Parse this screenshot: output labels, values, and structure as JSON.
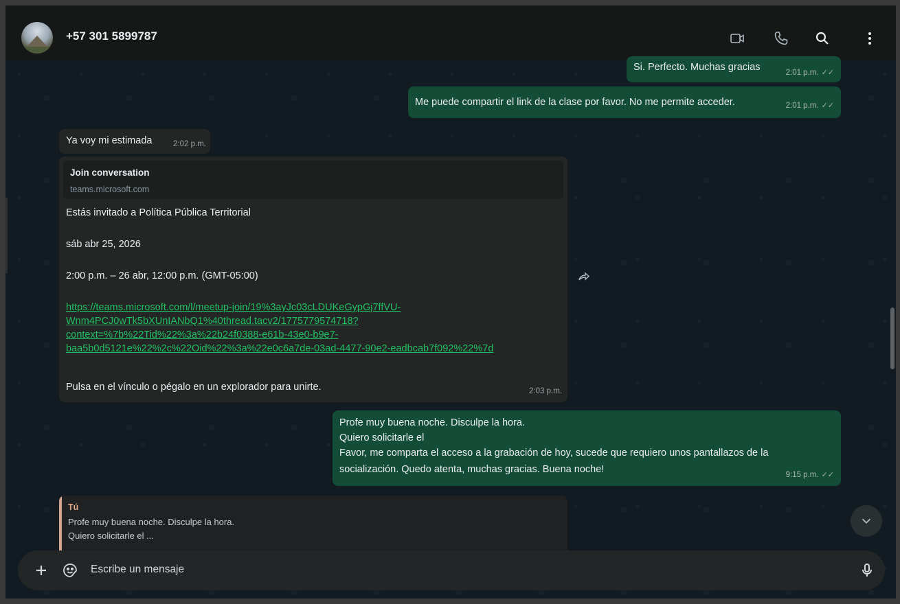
{
  "header": {
    "contact_name": "+57 301 5899787",
    "icons": [
      "video-call-icon",
      "voice-call-icon",
      "search-icon",
      "menu-icon"
    ]
  },
  "messages": [
    {
      "direction": "out",
      "text": "Si. Perfecto. Muchas gracias",
      "time": "2:01 p.m."
    },
    {
      "direction": "out",
      "text": "Me puede compartir el link de la clase por favor. No me permite acceder.",
      "time": "2:01 p.m."
    },
    {
      "direction": "in",
      "text": "Ya voy mi estimada",
      "time": "2:02 p.m."
    },
    {
      "direction": "in",
      "link_preview": {
        "title": "Join conversation",
        "domain": "teams.microsoft.com"
      },
      "line1": "Estás invitado a Política Pública Territorial",
      "line2": "sáb abr 25, 2026",
      "line3": "2:00 p.m. – 26 abr, 12:00 p.m. (GMT-05:00)",
      "url_lines": [
        "https://teams.microsoft.com/l/meetup-join/19%3ayJc03cLDUKeGypGj7ffVU-",
        "Wnm4PCJ0wTk5bXUnIANbQ1%40thread.tacv2/1775779574718?",
        "context=%7b%22Tid%22%3a%22b24f0388-e61b-43e0-b9e7-",
        "baa5b0d5121e%22%2c%22Oid%22%3a%22e0c6a7de-03ad-4477-90e2-eadbcab7f092%22%7d"
      ],
      "line4": "Pulsa en el vínculo o pégalo en un explorador para unirte.",
      "time": "2:03 p.m."
    },
    {
      "direction": "out",
      "lines": [
        "Profe muy buena noche. Disculpe la hora.",
        "Quiero solicitarle el",
        "Favor, me comparta el acceso a la grabación de hoy, sucede que requiero unos pantallazos de la",
        "socialización. Quedo atenta, muchas gracias. Buena noche!"
      ],
      "time": "9:15 p.m."
    }
  ],
  "reply": {
    "author": "Tú",
    "line1": "Profe muy buena noche. Disculpe la hora.",
    "line2": "Quiero solicitarle el ..."
  },
  "composer": {
    "placeholder": "Escribe un mensaje"
  },
  "colors": {
    "outgoing_bubble": "#144d37",
    "incoming_bubble": "#242626",
    "link": "#21c063",
    "reply_accent": "#d6a38f"
  }
}
